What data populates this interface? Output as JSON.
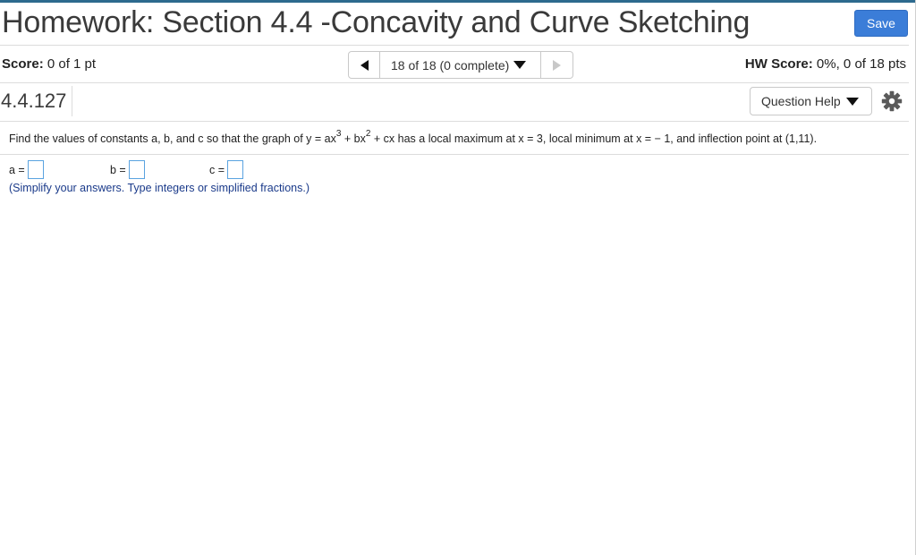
{
  "header": {
    "title": "Homework: Section 4.4 -Concavity and Curve Sketching",
    "save_label": "Save"
  },
  "status_bar": {
    "score_label": "Score:",
    "score_value": "0 of 1 pt",
    "pager_text": "18 of 18 (0 complete)",
    "hw_score_label": "HW Score:",
    "hw_score_value": "0%, 0 of 18 pts"
  },
  "question_bar": {
    "number": "4.4.127",
    "help_label": "Question Help"
  },
  "question": {
    "text_1": "Find the values of constants a, b, and c so that the graph of y = ax",
    "exp_1": "3",
    "text_2": " + bx",
    "exp_2": "2",
    "text_3": " + cx has a local maximum at x = 3, local minimum at x = − 1, and inflection point at (1,11)."
  },
  "answers": [
    {
      "label": "a =",
      "value": ""
    },
    {
      "label": "b =",
      "value": ""
    },
    {
      "label": "c =",
      "value": ""
    }
  ],
  "hint": "(Simplify your answers. Type integers or simplified fractions.)",
  "colors": {
    "accent": "#3b7dd8",
    "top_rule": "#2d6a8e",
    "hint_text": "#1a3a8a",
    "input_border": "#5aa3e0"
  },
  "icons": {
    "prev": "caret-left-icon",
    "next": "caret-right-icon",
    "dropdown": "caret-down-icon",
    "settings": "gear-icon"
  }
}
